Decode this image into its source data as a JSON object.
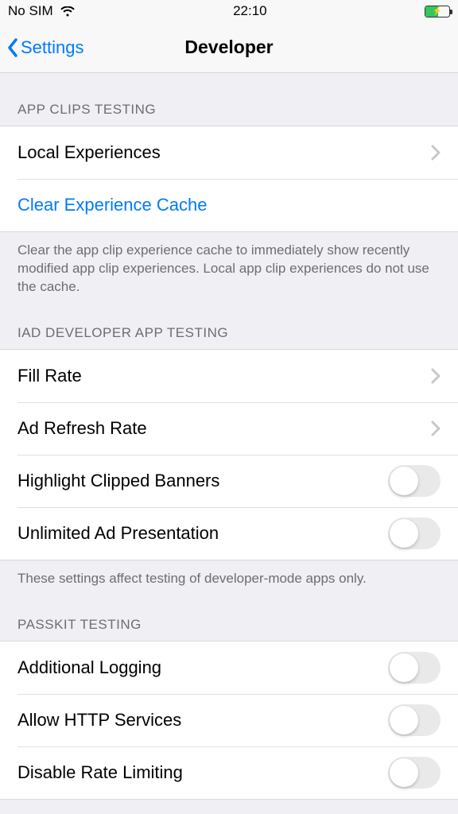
{
  "status": {
    "carrier": "No SIM",
    "time": "22:10"
  },
  "nav": {
    "back_label": "Settings",
    "title": "Developer"
  },
  "sections": {
    "app_clips": {
      "header": "App Clips Testing",
      "local_experiences": "Local Experiences",
      "clear_cache": "Clear Experience Cache",
      "footer": "Clear the app clip experience cache to immediately show recently modified app clip experiences. Local app clip experiences do not use the cache."
    },
    "iad": {
      "header": "iAd Developer App Testing",
      "fill_rate": "Fill Rate",
      "ad_refresh_rate": "Ad Refresh Rate",
      "highlight_clipped": "Highlight Clipped Banners",
      "unlimited_ad": "Unlimited Ad Presentation",
      "footer": "These settings affect testing of developer-mode apps only."
    },
    "passkit": {
      "header": "PassKit Testing",
      "additional_logging": "Additional Logging",
      "allow_http": "Allow HTTP Services",
      "disable_rate_limiting": "Disable Rate Limiting"
    }
  }
}
